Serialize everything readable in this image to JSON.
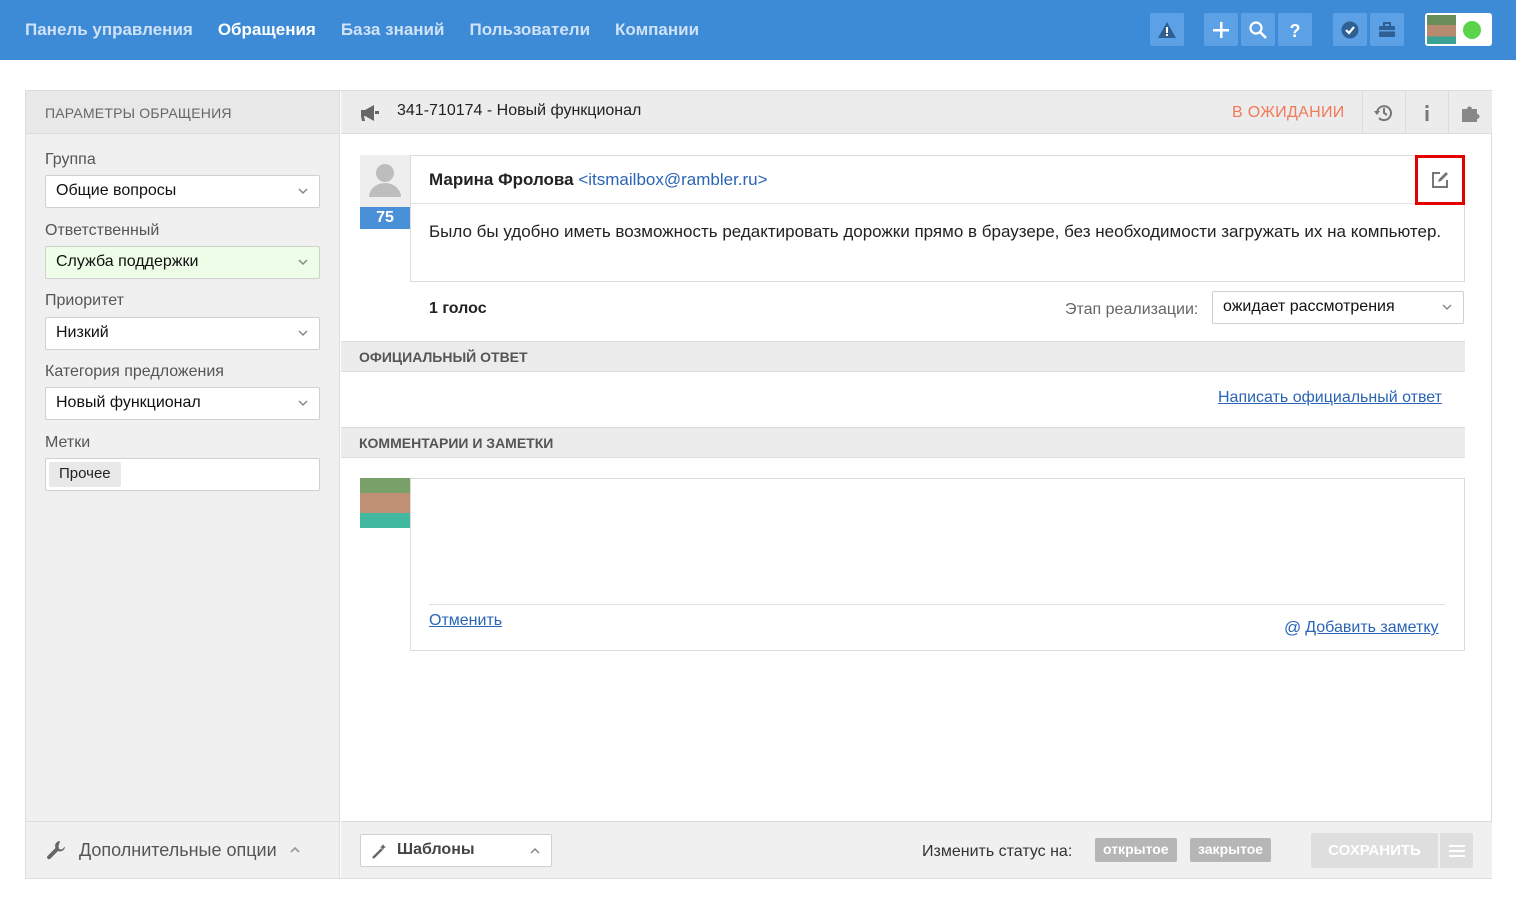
{
  "nav": {
    "items": [
      "Панель управления",
      "Обращения",
      "База знаний",
      "Пользователи",
      "Компании"
    ],
    "active": "Обращения"
  },
  "toolbar_icons": [
    "warning-icon",
    "plus-icon",
    "search-icon",
    "help-icon",
    "check-badge-icon",
    "briefcase-icon"
  ],
  "user": {
    "status_color": "#5cd34c"
  },
  "sidebar": {
    "title": "ПАРАМЕТРЫ ОБРАЩЕНИЯ",
    "group_label": "Группа",
    "group_value": "Общие вопросы",
    "assignee_label": "Ответственный",
    "assignee_value": "Служба поддержки",
    "priority_label": "Приоритет",
    "priority_value": "Низкий",
    "category_label": "Категория предложения",
    "category_value": "Новый функционал",
    "tags_label": "Метки",
    "tags": [
      "Прочее"
    ],
    "more_options": "Дополнительные опции"
  },
  "ticket": {
    "title": "341-710174 - Новый функционал",
    "status": "В ОЖИДАНИИ",
    "status_color": "#f07a5a",
    "author_name": "Марина Фролова",
    "author_email": "<itsmailbox@rambler.ru>",
    "vote_score": "75",
    "body": "Было бы удобно иметь возможность редактировать дорожки прямо в браузере, без необходимости загружать их на компьютер.",
    "votes_text": "1 голос",
    "stage_label": "Этап реализации:",
    "stage_value": "ожидает рассмотрения"
  },
  "official": {
    "title": "ОФИЦИАЛЬНЫЙ ОТВЕТ",
    "write_link": "Написать официальный ответ"
  },
  "comments": {
    "title": "КОММЕНТАРИИ И ЗАМЕТКИ",
    "cancel": "Отменить",
    "add_note": "Добавить заметку"
  },
  "footer": {
    "templates": "Шаблоны",
    "change_status_label": "Изменить статус на:",
    "status_open": "открытое",
    "status_closed": "закрытое",
    "save": "СОХРАНИТЬ"
  },
  "colors": {
    "topbar": "#3d8ad6",
    "accent": "#4a90d9",
    "highlight": "#e50000"
  }
}
